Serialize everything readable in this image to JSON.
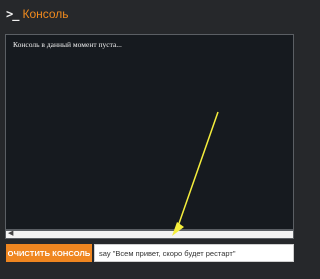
{
  "header": {
    "icon": "terminal-prompt-icon",
    "glyph": ">_",
    "title": "Консоль",
    "title_color": "#f08a1e"
  },
  "console": {
    "empty_text": "Консоль в данный момент пуста..."
  },
  "controls": {
    "clear_label": "ОЧИСТИТЬ КОНСОЛЬ",
    "accent": "#ef8620",
    "command_value": "say \"Всем привет, скоро будет рестарт\""
  },
  "annotation": {
    "icon": "arrow-annotation-icon",
    "color": "#f5ee3c"
  }
}
